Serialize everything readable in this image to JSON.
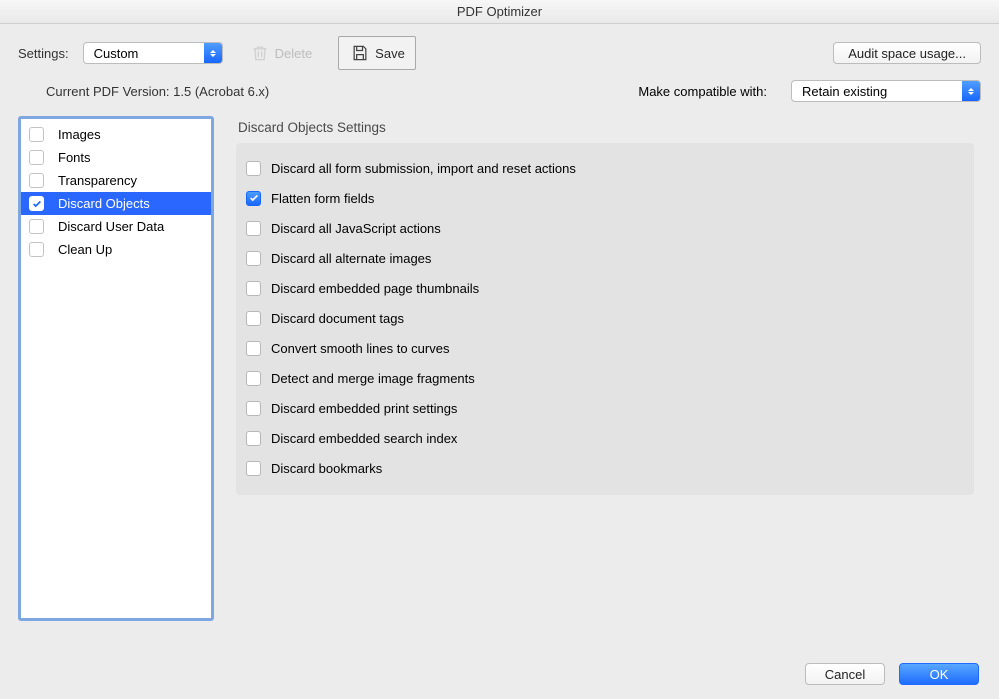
{
  "window_title": "PDF Optimizer",
  "settings_label": "Settings:",
  "settings_value": "Custom",
  "delete_label": "Delete",
  "save_label": "Save",
  "audit_label": "Audit space usage...",
  "version_text": "Current PDF Version: 1.5 (Acrobat 6.x)",
  "compat_label": "Make compatible with:",
  "compat_value": "Retain existing",
  "sidebar": {
    "items": [
      {
        "label": "Images",
        "checked": false,
        "selected": false
      },
      {
        "label": "Fonts",
        "checked": false,
        "selected": false
      },
      {
        "label": "Transparency",
        "checked": false,
        "selected": false
      },
      {
        "label": "Discard Objects",
        "checked": true,
        "selected": true
      },
      {
        "label": "Discard User Data",
        "checked": false,
        "selected": false
      },
      {
        "label": "Clean Up",
        "checked": false,
        "selected": false
      }
    ]
  },
  "panel": {
    "title": "Discard Objects Settings",
    "options": [
      {
        "label": "Discard all form submission, import and reset actions",
        "checked": false
      },
      {
        "label": "Flatten form fields",
        "checked": true
      },
      {
        "label": "Discard all JavaScript actions",
        "checked": false
      },
      {
        "label": "Discard all alternate images",
        "checked": false
      },
      {
        "label": "Discard embedded page thumbnails",
        "checked": false
      },
      {
        "label": "Discard document tags",
        "checked": false
      },
      {
        "label": "Convert smooth lines to curves",
        "checked": false
      },
      {
        "label": "Detect and merge image fragments",
        "checked": false
      },
      {
        "label": "Discard embedded print settings",
        "checked": false
      },
      {
        "label": "Discard embedded search index",
        "checked": false
      },
      {
        "label": "Discard bookmarks",
        "checked": false
      }
    ]
  },
  "footer": {
    "cancel": "Cancel",
    "ok": "OK"
  }
}
